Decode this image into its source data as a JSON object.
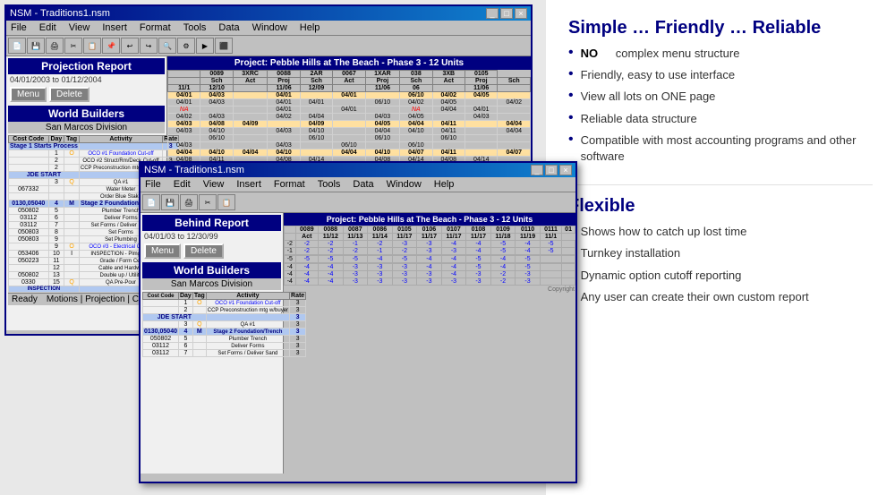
{
  "left": {
    "mainWindow": {
      "title": "NSM - Traditions1.nsm",
      "menuItems": [
        "File",
        "Edit",
        "View",
        "Insert",
        "Format",
        "Tools",
        "Data",
        "Window",
        "Help"
      ],
      "projectionReport": {
        "label": "Projection Report",
        "dateRange": "04/01/2003 to 01/12/2004",
        "buttons": [
          "Menu",
          "Delete"
        ]
      },
      "worldBuilders": {
        "title": "World Builders",
        "subtitle": "San Marcos Division"
      },
      "project": {
        "title": "Project: Pebble Hills at The Beach - Phase 3 - 12 Units"
      }
    },
    "secondWindow": {
      "title": "NSM - Traditions1.nsm",
      "menuItems": [
        "File",
        "Edit",
        "View",
        "Insert",
        "Format",
        "Tools",
        "Data",
        "Window",
        "Help"
      ],
      "behindReport": {
        "label": "Behind Report",
        "dateRange": "04/01/03 to 12/30/99",
        "buttons": [
          "Menu",
          "Delete"
        ]
      },
      "worldBuilders": {
        "title": "World Builders",
        "subtitle": "San Marcos Division"
      },
      "project": {
        "title": "Project: Pebble Hills at The Beach - Phase 3 - 12 Units"
      }
    }
  },
  "right": {
    "section1": {
      "title": "Simple … Friendly … Reliable",
      "bullets": [
        {
          "bold": "NO",
          "text": "complex menu structure"
        },
        {
          "bold": "",
          "text": "Friendly, easy to use interface"
        },
        {
          "bold": "",
          "text": "View all lots on ONE page"
        },
        {
          "bold": "",
          "text": "Reliable data structure"
        },
        {
          "bold": "",
          "text": "Compatible with most accounting programs and other software"
        }
      ]
    },
    "section2": {
      "title": "Flexible",
      "bullets": [
        {
          "bold": "",
          "text": "Shows how to catch up lost time"
        },
        {
          "bold": "",
          "text": "Turnkey installation"
        },
        {
          "bold": "",
          "text": "Dynamic option cutoff reporting"
        },
        {
          "bold": "",
          "text": "Any user can create their own custom report"
        }
      ]
    }
  }
}
